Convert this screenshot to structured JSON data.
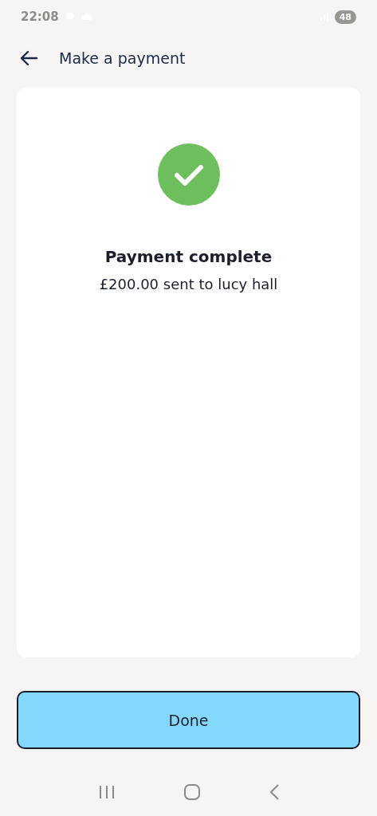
{
  "status_bar": {
    "time": "22:08",
    "battery": "48"
  },
  "header": {
    "title": "Make a payment"
  },
  "result": {
    "complete": true,
    "title": "Payment complete",
    "message": "£200.00 sent to lucy hall"
  },
  "buttons": [
    {
      "label": "Done"
    }
  ]
}
